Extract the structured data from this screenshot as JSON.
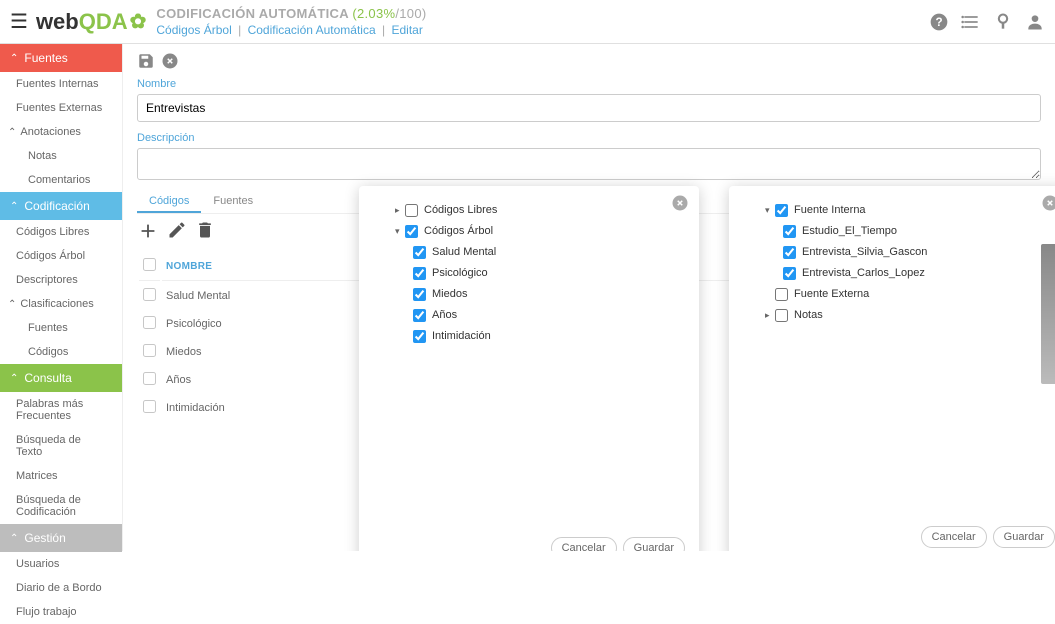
{
  "header": {
    "logo": {
      "web": "web",
      "qda": "QDA"
    },
    "bc_title": "CODIFICACIÓN AUTOMÁTICA",
    "bc_pct": "(2.03%",
    "bc_max": "/100)",
    "bc_path": [
      "Códigos Árbol",
      "Codificación Automática",
      "Editar"
    ]
  },
  "sidebar": {
    "sections": [
      {
        "label": "Fuentes",
        "class": "red"
      },
      {
        "items": [
          "Fuentes Internas",
          "Fuentes Externas"
        ]
      },
      {
        "sublabel": "Anotaciones"
      },
      {
        "subitems": [
          "Notas",
          "Comentarios"
        ]
      },
      {
        "label": "Codificación",
        "class": "light"
      },
      {
        "items2": [
          "Códigos Libres",
          "Códigos Árbol",
          "Descriptores"
        ]
      },
      {
        "sublabel2": "Clasificaciones"
      },
      {
        "subitems2": [
          "Fuentes",
          "Códigos"
        ]
      },
      {
        "label3": "Consulta"
      },
      {
        "items3": [
          "Palabras más Frecuentes",
          "Búsqueda de Texto",
          "Matrices",
          "Búsqueda de Codificación"
        ]
      },
      {
        "label4": "Gestión"
      },
      {
        "items4": [
          "Usuarios",
          "Diario de a Bordo",
          "Flujo trabajo"
        ]
      }
    ],
    "fuentes": "Fuentes",
    "fuentes_internas": "Fuentes Internas",
    "fuentes_externas": "Fuentes Externas",
    "anotaciones": "Anotaciones",
    "notas": "Notas",
    "comentarios": "Comentarios",
    "codificacion": "Codificación",
    "codigos_libres": "Códigos Libres",
    "codigos_arbol": "Códigos Árbol",
    "descriptores": "Descriptores",
    "clasificaciones": "Clasificaciones",
    "s_fuentes": "Fuentes",
    "s_codigos": "Códigos",
    "consulta": "Consulta",
    "palabras": "Palabras más Frecuentes",
    "busqueda_texto": "Búsqueda de Texto",
    "matrices": "Matrices",
    "busqueda_cod": "Búsqueda de Codificación",
    "gestion": "Gestión",
    "usuarios": "Usuarios",
    "diario": "Diario de a Bordo",
    "flujo": "Flujo trabajo"
  },
  "form": {
    "nombre_label": "Nombre",
    "nombre_value": "Entrevistas",
    "desc_label": "Descripción",
    "tab_codigos": "Códigos",
    "tab_fuentes": "Fuentes",
    "col_nombre": "NOMBRE",
    "rows": [
      "Salud Mental",
      "Psicológico",
      "Miedos",
      "Años",
      "Intimidación"
    ]
  },
  "modal1": {
    "codigos_libres": "Códigos Libres",
    "codigos_arbol": "Códigos Árbol",
    "salud_mental": "Salud Mental",
    "psicologico": "Psicológico",
    "miedos": "Miedos",
    "anos": "Años",
    "intimidacion": "Intimidación",
    "cancelar": "Cancelar",
    "guardar": "Guardar"
  },
  "modal2": {
    "fuente_interna": "Fuente Interna",
    "estudio": "Estudio_El_Tiempo",
    "entrevista_silvia": "Entrevista_Silvia_Gascon",
    "entrevista_carlos": "Entrevista_Carlos_Lopez",
    "fuente_externa": "Fuente Externa",
    "notas": "Notas",
    "cancelar": "Cancelar",
    "guardar": "Guardar"
  }
}
